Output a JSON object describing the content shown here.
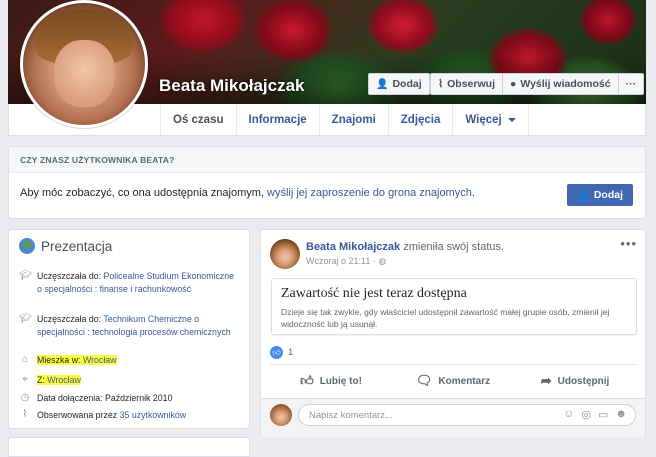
{
  "profile": {
    "name": "Beata Mikołajczak"
  },
  "cover_actions": {
    "add_friend": "Dodaj",
    "follow": "Obserwuj",
    "message": "Wyślij wiadomość",
    "more": "···"
  },
  "tabs": [
    {
      "label": "Oś czasu",
      "active": true
    },
    {
      "label": "Informacje"
    },
    {
      "label": "Znajomi"
    },
    {
      "label": "Zdjęcia"
    },
    {
      "label": "Więcej"
    }
  ],
  "friend_prompt": {
    "heading": "CZY ZNASZ UŻYTKOWNIKA BEATA?",
    "text": "Aby móc zobaczyć, co ona udostępnia znajomym, ",
    "link": "wyślij jej zaproszenie do grona znajomych",
    "text_end": ".",
    "button": "Dodaj"
  },
  "intro": {
    "title": "Prezentacja",
    "items": [
      {
        "icon": "graduation-cap-icon",
        "prefix": "Uczęszczała do: ",
        "link": "Policealne Studium Ekonomiczne o specjalności : finanse i rachunkowość"
      },
      {
        "icon": "graduation-cap-icon",
        "prefix": "Uczęszczała do: ",
        "link": "Technikum Chemiczne o specjalności : technologia procesów chemicznych"
      },
      {
        "icon": "home-icon",
        "prefix": "Mieszka w: ",
        "link": "Wrocław"
      },
      {
        "icon": "map-pin-icon",
        "prefix": "Z: ",
        "link": "Wrocław"
      },
      {
        "icon": "clock-icon",
        "prefix": "Data dołączenia: Październik 2010",
        "link": ""
      },
      {
        "icon": "rss-icon",
        "prefix": "Obserwowana przez ",
        "link": "35 użytkowników"
      }
    ]
  },
  "post": {
    "author": "Beata Mikołajczak",
    "action": " zmieniła swój status.",
    "time": "Wczoraj o 21:11 · ",
    "more": "•••",
    "unavailable_title": "Zawartość nie jest teraz dostępna",
    "unavailable_desc": "Dzieje się tak zwykle, gdy właściciel udostępnił zawartość małej grupie osób, zmienił jej widoczność lub ją usunął.",
    "like_count": "1",
    "actions": {
      "like": "Lubię to!",
      "comment": "Komentarz",
      "share": "Udostępnij"
    },
    "comment_placeholder": "Napisz komentarz..."
  },
  "colors": {
    "link": "#385898",
    "button_blue": "#4267b2",
    "highlight": "#ffff3b",
    "background": "#e9ebee"
  }
}
